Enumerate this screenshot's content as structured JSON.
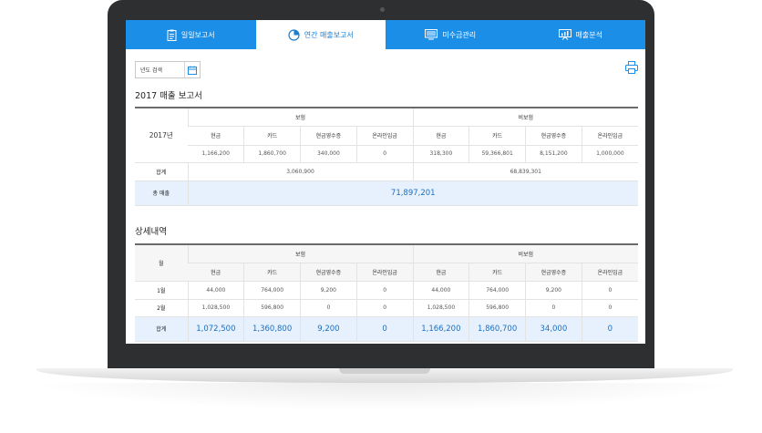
{
  "tabs": [
    {
      "label": "일일보고서",
      "icon": "clipboard-icon"
    },
    {
      "label": "연간 매출보고서",
      "icon": "pie-chart-icon"
    },
    {
      "label": "미수금관리",
      "icon": "monitor-icon"
    },
    {
      "label": "매출분석",
      "icon": "presentation-icon"
    }
  ],
  "filter": {
    "year_label": "년도 검색",
    "icon": "calendar-icon"
  },
  "print_icon": "printer-icon",
  "report": {
    "title": "2017 매출 보고서",
    "year": "2017년",
    "group_insured": "보험",
    "group_uninsured": "비보험",
    "columns": [
      "현금",
      "카드",
      "현금영수증",
      "온라인입금"
    ],
    "insured_values": [
      "1,166,200",
      "1,860,700",
      "340,000",
      "0"
    ],
    "uninsured_values": [
      "318,300",
      "59,366,801",
      "8,151,200",
      "1,000,000"
    ],
    "subtotal_label": "합계",
    "insured_subtotal": "3,060,900",
    "uninsured_subtotal": "68,839,301",
    "total_label": "총 매출",
    "total_value": "71,897,201"
  },
  "detail": {
    "title": "상세내역",
    "month_label": "월",
    "group_insured": "보험",
    "group_uninsured": "비보험",
    "columns": [
      "현금",
      "카드",
      "현금영수증",
      "온라인입금"
    ],
    "rows": [
      {
        "month": "1월",
        "values": [
          "44,000",
          "764,000",
          "9,200",
          "0",
          "44,000",
          "764,000",
          "9,200",
          "0"
        ]
      },
      {
        "month": "2월",
        "values": [
          "1,028,500",
          "596,800",
          "0",
          "0",
          "1,028,500",
          "596,800",
          "0",
          "0"
        ]
      }
    ],
    "total_label": "합계",
    "total_values": [
      "1,072,500",
      "1,360,800",
      "9,200",
      "0",
      "1,166,200",
      "1,860,700",
      "34,000",
      "0"
    ]
  },
  "colors": {
    "accent": "#1b8ee8",
    "total_bg": "#e6f1fd",
    "total_text": "#1c6fc0"
  }
}
